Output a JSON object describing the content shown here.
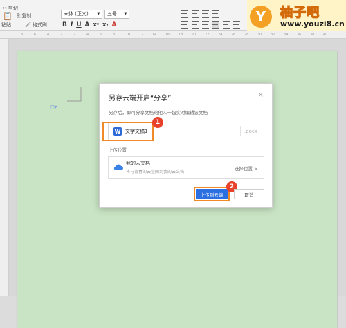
{
  "ribbon": {
    "cut": "剪切",
    "paste": "粘贴",
    "copy": "复制",
    "format_painter": "格式刷",
    "font_name": "宋体 (正文)",
    "font_size": "五号",
    "format_buttons": [
      "B",
      "I",
      "U",
      "A",
      "X²",
      "X₂",
      "A"
    ]
  },
  "ruler_numbers": [
    "8",
    "6",
    "4",
    "2",
    "2",
    "4",
    "6",
    "8",
    "10",
    "12",
    "14",
    "16",
    "18",
    "20",
    "22",
    "24",
    "26",
    "28",
    "30",
    "32",
    "34",
    "36",
    "38",
    "40"
  ],
  "watermark": {
    "logo_letter": "Y",
    "title": "柚子吧",
    "url": "www.youzi8.cn"
  },
  "dialog": {
    "title": "另存云端开启“分享”",
    "close": "×",
    "description": "另存后，即可分享文档给他人一起实时编辑该文档",
    "file_name": "文字文稿1",
    "extension": ".docx",
    "location_label": "上传位置",
    "location_name": "我的云文档",
    "location_desc": "将与青春的云空间到我的云文档",
    "change_location": "选择位置 >",
    "upload_button": "上传到云端",
    "cancel_button": "取消",
    "badge1": "1",
    "badge2": "2"
  },
  "colors": {
    "page_bg": "#c9e4c4",
    "accent_blue": "#2c6fe0",
    "highlight_orange": "#f08a28",
    "badge_red": "#e8412c"
  }
}
